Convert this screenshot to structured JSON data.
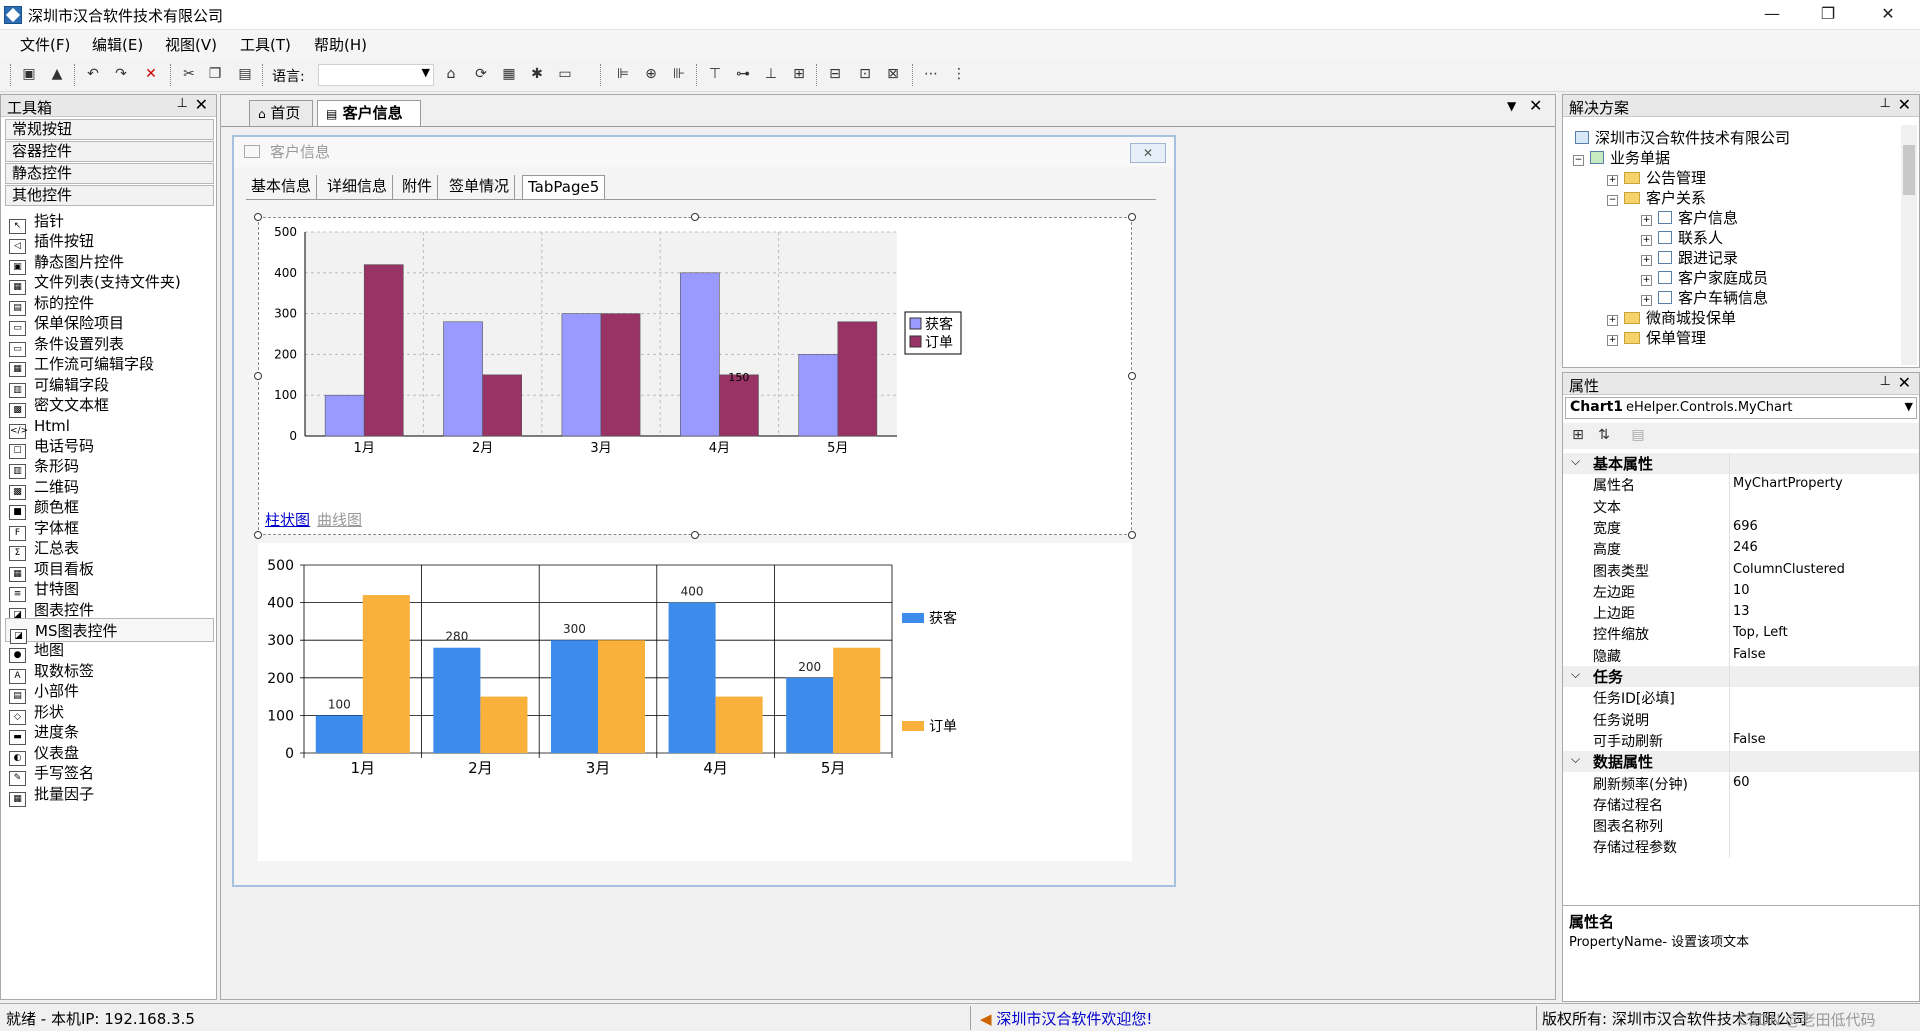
{
  "window": {
    "title": "深圳市汉合软件技术有限公司",
    "minimize": "—",
    "maximize": "❐",
    "close": "✕"
  },
  "menu": [
    "文件(F)",
    "编辑(E)",
    "视图(V)",
    "工具(T)",
    "帮助(H)"
  ],
  "toolbar": {
    "language_label": "语言:",
    "language_value": ""
  },
  "toolbox": {
    "title": "工具箱",
    "groups": [
      "常规按钮",
      "容器控件",
      "静态控件",
      "其他控件"
    ],
    "items": [
      "指针",
      "插件按钮",
      "静态图片控件",
      "文件列表(支持文件夹)",
      "标的控件",
      "保单保险项目",
      "条件设置列表",
      "工作流可编辑字段",
      "可编辑字段",
      "密文文本框",
      "Html",
      "电话号码",
      "条形码",
      "二维码",
      "颜色框",
      "字体框",
      "汇总表",
      "项目看板",
      "甘特图",
      "图表控件",
      "MS图表控件",
      "地图",
      "取数标签",
      "小部件",
      "形状",
      "进度条",
      "仪表盘",
      "手写签名",
      "批量因子"
    ],
    "selected_item": "MS图表控件"
  },
  "doc_tabs": [
    "首页",
    "客户信息"
  ],
  "form": {
    "title": "客户信息",
    "tabs": [
      "基本信息",
      "详细信息",
      "附件",
      "签单情况",
      "TabPage5"
    ],
    "selected_tab": "TabPage5",
    "chart_links": [
      "柱状图",
      "曲线图"
    ]
  },
  "chart_data": [
    {
      "type": "bar",
      "categories": [
        "1月",
        "2月",
        "3月",
        "4月",
        "5月"
      ],
      "series": [
        {
          "name": "获客",
          "values": [
            100,
            280,
            300,
            400,
            200
          ],
          "color": "#9999ff"
        },
        {
          "name": "订单",
          "values": [
            420,
            150,
            300,
            150,
            280
          ],
          "color": "#993366"
        }
      ],
      "ylim": [
        0,
        500
      ],
      "yticks": [
        0,
        100,
        200,
        300,
        400,
        500
      ],
      "annotations": [
        {
          "category": "4月",
          "series": "订单",
          "label": "150"
        }
      ],
      "grid": true,
      "legend": "right"
    },
    {
      "type": "bar",
      "categories": [
        "1月",
        "2月",
        "3月",
        "4月",
        "5月"
      ],
      "series": [
        {
          "name": "获客",
          "values": [
            100,
            280,
            300,
            400,
            200
          ],
          "color": "#3d8bea",
          "labels": [
            "100",
            "280",
            "300",
            "400",
            "200"
          ]
        },
        {
          "name": "订单",
          "values": [
            420,
            150,
            300,
            150,
            280
          ],
          "color": "#f9b13b"
        }
      ],
      "ylim": [
        0,
        500
      ],
      "yticks": [
        0,
        100,
        200,
        300,
        400,
        500
      ],
      "grid": true,
      "legend": "right"
    }
  ],
  "solution": {
    "title": "解决方案",
    "root": "深圳市汉合软件技术有限公司",
    "nodes": [
      "业务单据",
      "公告管理",
      "客户关系",
      "客户信息",
      "联系人",
      "跟进记录",
      "客户家庭成员",
      "客户车辆信息",
      "微商城投保单",
      "保单管理"
    ]
  },
  "properties": {
    "title": "属性",
    "object": "Chart1",
    "object_type": "eHelper.Controls.MyChart",
    "categories": [
      "基本属性",
      "任务",
      "数据属性"
    ],
    "basic": [
      {
        "k": "属性名",
        "v": "MyChartProperty"
      },
      {
        "k": "文本",
        "v": ""
      },
      {
        "k": "宽度",
        "v": "696"
      },
      {
        "k": "高度",
        "v": "246"
      },
      {
        "k": "图表类型",
        "v": "ColumnClustered"
      },
      {
        "k": "左边距",
        "v": "10"
      },
      {
        "k": "上边距",
        "v": "13"
      },
      {
        "k": "控件缩放",
        "v": "Top, Left"
      },
      {
        "k": "隐藏",
        "v": "False"
      }
    ],
    "task": [
      {
        "k": "任务ID[必填]",
        "v": ""
      },
      {
        "k": "任务说明",
        "v": ""
      },
      {
        "k": "可手动刷新",
        "v": "False"
      }
    ],
    "data": [
      {
        "k": "刷新频率(分钟)",
        "v": "60"
      },
      {
        "k": "存储过程名",
        "v": ""
      },
      {
        "k": "图表名称列",
        "v": ""
      },
      {
        "k": "存储过程参数",
        "v": ""
      }
    ],
    "desc_title": "属性名",
    "desc_text": "PropertyName- 设置该项文本"
  },
  "status": {
    "left": "就绪 - 本机IP: 192.168.3.5",
    "center": "深圳市汉合软件欢迎您!",
    "right": "版权所有: 深圳市汉合软件技术有限公司",
    "watermark": "CSDN @老田低代码"
  }
}
